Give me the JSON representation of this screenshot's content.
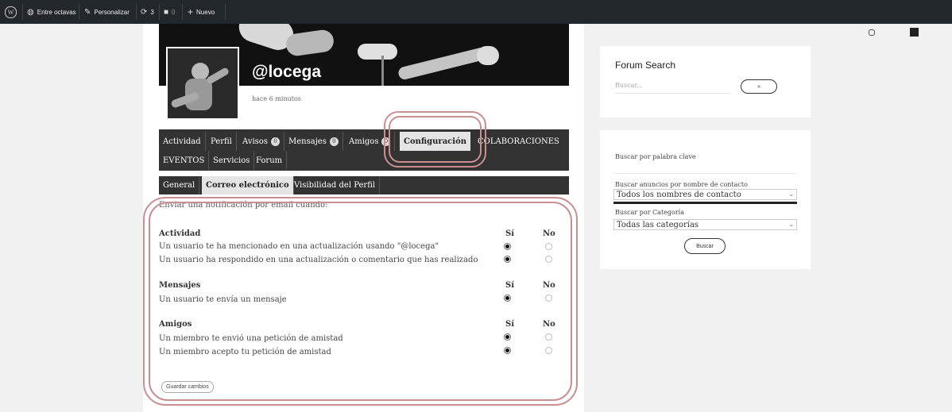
{
  "adminbar": {
    "site_name": "Entre octavas",
    "customize": "Personalizar",
    "updates_count": "3",
    "comments_count": "0",
    "new_label": "Nuevo"
  },
  "profile": {
    "username": "@locega",
    "time_ago": "hace 6 minutos"
  },
  "nav": {
    "items": [
      "Actividad",
      "Perfil",
      "Avisos",
      "Mensajes",
      "Amigos",
      "Configuración",
      "COLABORACIONES",
      "EVENTOS",
      "Servicios",
      "Forum"
    ],
    "avisos_badge": "0",
    "mensajes_badge": "0",
    "amigos_badge": "0"
  },
  "subnav": {
    "items": [
      "General",
      "Correo electrónico",
      "Visibilidad del Perfil"
    ]
  },
  "settings": {
    "intro": "Enviar una notificación por email cuando:",
    "col_yes": "Sí",
    "col_no": "No",
    "sections": [
      {
        "title": "Actividad",
        "rows": [
          "Un usuario te ha mencionado en una actualización usando \"@locega\"",
          "Un usuario ha respondido en una actualización o comentario que has realizado"
        ]
      },
      {
        "title": "Mensajes",
        "rows": [
          "Un usuario te envía un mensaje"
        ]
      },
      {
        "title": "Amigos",
        "rows": [
          "Un miembro te envió una petición de amistad",
          "Un miembro acepto tu petición de amistad"
        ]
      }
    ],
    "save_label": "Guardar cambios"
  },
  "forum_search": {
    "title": "Forum Search",
    "placeholder": "Buscar...",
    "button": "»"
  },
  "ads_search": {
    "keyword_label": "Buscar por palabra clave",
    "contact_label": "Buscar anuncios por nombre de contacto",
    "contact_value": "Todos los nombres de contacto",
    "category_label": "Buscar por Categoría",
    "category_value": "Todas las categorías",
    "button": "Buscar"
  },
  "colors": {
    "adminbar": "#23282d",
    "nav_bg": "#333333",
    "highlight": "#c98f90"
  }
}
